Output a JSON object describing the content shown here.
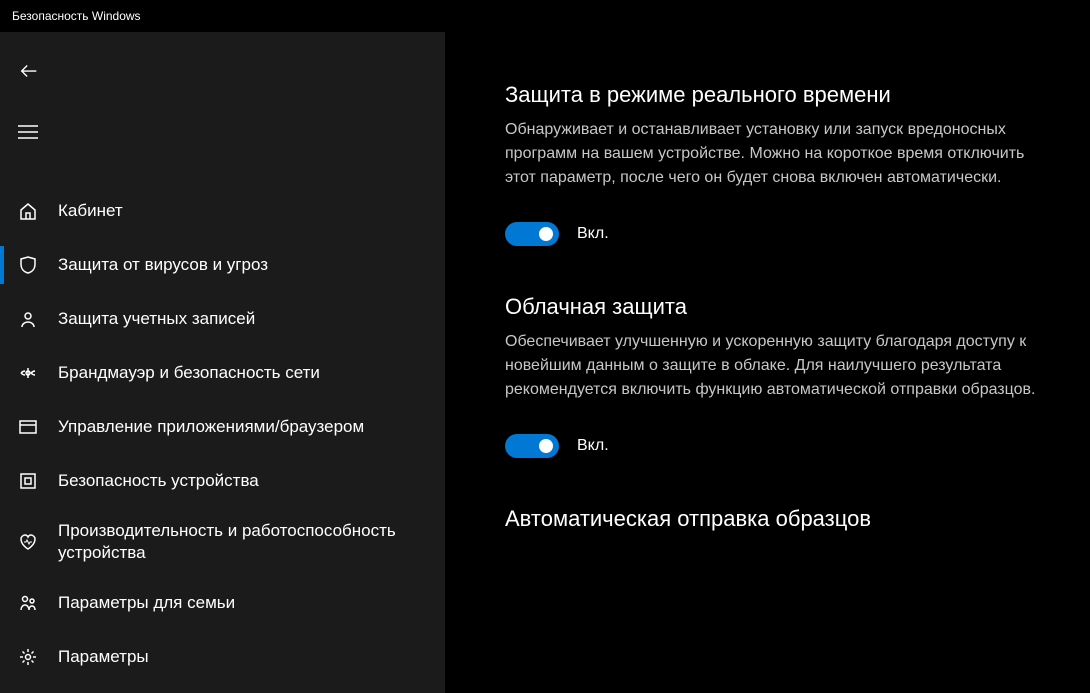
{
  "window": {
    "title": "Безопасность Windows"
  },
  "sidebar": {
    "items": [
      {
        "label": "Кабинет"
      },
      {
        "label": "Защита от вирусов и угроз"
      },
      {
        "label": "Защита учетных записей"
      },
      {
        "label": "Брандмауэр и безопасность сети"
      },
      {
        "label": "Управление приложениями/браузером"
      },
      {
        "label": "Безопасность устройства"
      },
      {
        "label": "Производительность и работоспособность устройства"
      },
      {
        "label": "Параметры для семьи"
      },
      {
        "label": "Параметры"
      }
    ]
  },
  "content": {
    "sections": [
      {
        "title": "Защита в режиме реального времени",
        "description": "Обнаруживает и останавливает установку или запуск вредоносных программ на вашем устройстве. Можно на короткое время отключить этот параметр, после чего он будет снова включен автоматически.",
        "toggle_state": "Вкл."
      },
      {
        "title": "Облачная защита",
        "description": "Обеспечивает улучшенную и ускоренную защиту благодаря доступу к новейшим данным о защите в облаке. Для наилучшего результата рекомендуется включить функцию автоматической отправки образцов.",
        "toggle_state": "Вкл."
      },
      {
        "title": "Автоматическая отправка образцов"
      }
    ]
  }
}
